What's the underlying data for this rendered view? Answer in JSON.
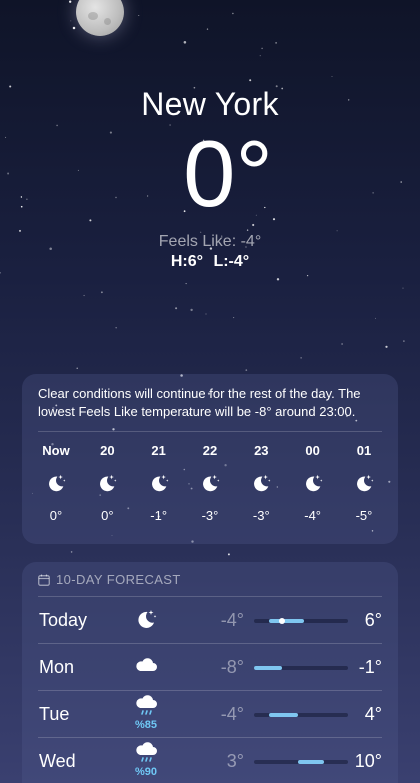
{
  "location": {
    "city": "New York",
    "temperature": "0°",
    "feels_like": "Feels Like: -4°",
    "high": "H:6°",
    "low": "L:-4°"
  },
  "hourly": {
    "summary": "Clear conditions will continue for the rest of the day. The lowest Feels Like temperature will be -8° around 23:00.",
    "hours": [
      {
        "label": "Now",
        "icon": "moon-stars-icon",
        "temp": "0°"
      },
      {
        "label": "20",
        "icon": "moon-stars-icon",
        "temp": "0°"
      },
      {
        "label": "21",
        "icon": "moon-stars-icon",
        "temp": "-1°"
      },
      {
        "label": "22",
        "icon": "moon-stars-icon",
        "temp": "-3°"
      },
      {
        "label": "23",
        "icon": "moon-stars-icon",
        "temp": "-3°"
      },
      {
        "label": "00",
        "icon": "moon-stars-icon",
        "temp": "-4°"
      },
      {
        "label": "01",
        "icon": "moon-stars-icon",
        "temp": "-5°"
      }
    ]
  },
  "forecast": {
    "title": "10-DAY FORECAST",
    "days": [
      {
        "day": "Today",
        "icon": "moon-stars-icon",
        "precip": "",
        "low": "-4°",
        "high": "6°",
        "bar_start": 0.16,
        "bar_end": 0.53,
        "current": 0.3
      },
      {
        "day": "Mon",
        "icon": "cloud-icon",
        "precip": "",
        "low": "-8°",
        "high": "-1°",
        "bar_start": 0.0,
        "bar_end": 0.3,
        "current": null
      },
      {
        "day": "Tue",
        "icon": "cloud-rain-icon",
        "precip": "%85",
        "low": "-4°",
        "high": "4°",
        "bar_start": 0.16,
        "bar_end": 0.47,
        "current": null
      },
      {
        "day": "Wed",
        "icon": "cloud-rain-icon",
        "precip": "%90",
        "low": "3°",
        "high": "10°",
        "bar_start": 0.47,
        "bar_end": 0.74,
        "current": null
      }
    ]
  },
  "colors": {
    "bar": "#7fc6f0",
    "precip": "#6fc8f5"
  }
}
